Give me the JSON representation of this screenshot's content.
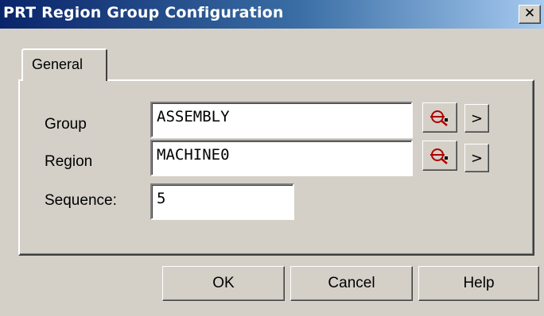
{
  "window": {
    "title": "PRT Region Group Configuration",
    "close_glyph": "✕"
  },
  "tabs": [
    {
      "label": "General",
      "selected": true
    }
  ],
  "form": {
    "group": {
      "label": "Group",
      "value": "ASSEMBLY"
    },
    "region": {
      "label": "Region",
      "value": "MACHINE0"
    },
    "sequence": {
      "label": "Sequence:",
      "value": "5"
    }
  },
  "icons": {
    "lookup": "lookup-icon",
    "expand": "chevron-right-icon",
    "expand_glyph": ">"
  },
  "buttons": {
    "ok": "OK",
    "cancel": "Cancel",
    "help": "Help"
  },
  "colors": {
    "title_gradient_start": "#0a246a",
    "title_gradient_end": "#a6caf0",
    "face": "#d4d0c8",
    "lookup_icon": "#b00000"
  }
}
